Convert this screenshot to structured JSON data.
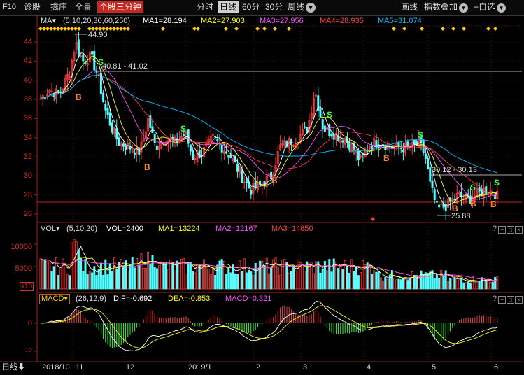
{
  "toolbar": {
    "f10": "F10",
    "diagnose": "诊股",
    "capture": "擒庄",
    "panorama": "全景",
    "stock_minutes": "个股三分钟",
    "intraday": "分时",
    "daily": "日线",
    "min60": "60分",
    "min30": "30分",
    "weekly": "周线",
    "draw": "画线",
    "index_overlay": "指数叠加",
    "add_self": "+自选"
  },
  "ma_legend": {
    "name": "MA",
    "params": "(5,10,20,30,60,250)",
    "ma1": "MA1=28.194",
    "ma2": "MA2=27.903",
    "ma3": "MA3=27.956",
    "ma4": "MA4=28.935",
    "ma5": "MA5=31.074"
  },
  "vol_legend": {
    "name": "VOL",
    "params": "(5,10,20)",
    "vol": "VOL=2400",
    "ma1": "MA1=13224",
    "ma2": "MA2=12167",
    "ma3": "MA3=14650"
  },
  "macd_legend": {
    "name": "MACD",
    "params": "(26,12,9)",
    "dif": "DIF=-0.692",
    "dea": "DEA=-0.853",
    "macd": "MACD=0.321"
  },
  "price_axis": [
    "44",
    "42",
    "40",
    "38",
    "36",
    "34",
    "32",
    "30",
    "28",
    "26"
  ],
  "vol_axis": [
    "10000",
    "5000",
    "x10"
  ],
  "macd_axis": [
    "0",
    "-2"
  ],
  "annotations": {
    "high": "44.90",
    "range1": "40.81 - 41.02",
    "range2": "30.12 - 30.13",
    "low": "25.88",
    "buy": "B",
    "sell": "S"
  },
  "date_axis": {
    "mode": "日线",
    "labels": [
      "2018/10",
      "11",
      "12",
      "2019/1",
      "2",
      "3",
      "4",
      "5",
      "6"
    ]
  },
  "colors": {
    "up": "#ff3c3c",
    "down": "#54ffff",
    "ma1": "#ffffff",
    "ma2": "#ffff00",
    "ma3": "#ff50ff",
    "ma4": "#ff4040",
    "ma5": "#00c0ff"
  }
}
